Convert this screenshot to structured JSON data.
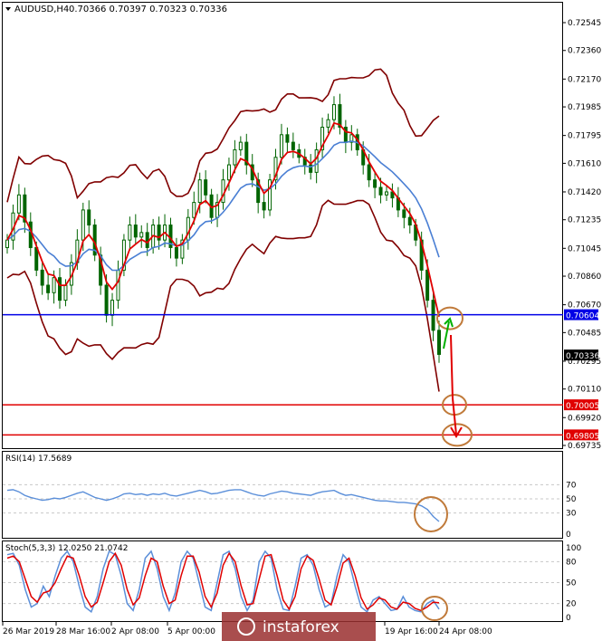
{
  "header": {
    "symbol_label": "AUDUSD,H4",
    "ohlc": "0.70366 0.70397 0.70323 0.70336"
  },
  "colors": {
    "candle": "#006400",
    "bollinger": "#800000",
    "ema_fast": "#e00000",
    "ema_slow": "#4a7fd4",
    "support_line": "#0000e6",
    "target_line": "#e00000",
    "rsi": "#5b8fd9",
    "stoch_main": "#5b8fd9",
    "stoch_signal": "#e00000",
    "annotation_circle": "#c07a3a",
    "arrow_up": "#00b000",
    "arrow_down": "#e00000"
  },
  "chart_data": [
    {
      "type": "candlestick",
      "panel": "price",
      "ylim": [
        0.697,
        0.724
      ],
      "y_ticks": [
        "0.72545",
        "0.72360",
        "0.72170",
        "0.71985",
        "0.71795",
        "0.71610",
        "0.71420",
        "0.71235",
        "0.71045",
        "0.70860",
        "0.70670",
        "0.70485",
        "0.70295",
        "0.70110",
        "0.69920",
        "0.69735"
      ],
      "y_tick_values": [
        0.72545,
        0.7236,
        0.7217,
        0.71985,
        0.71795,
        0.7161,
        0.7142,
        0.71235,
        0.71045,
        0.7086,
        0.7067,
        0.70485,
        0.70295,
        0.7011,
        0.6992,
        0.69735
      ],
      "x_ticks": [
        "26 Mar 2019",
        "28 Mar 16:00",
        "2 Apr 08:00",
        "5 Apr 00:00",
        "19 Apr 16:00",
        "24 Apr 08:00"
      ],
      "close": [
        0.711,
        0.7128,
        0.714,
        0.7122,
        0.7105,
        0.709,
        0.708,
        0.7075,
        0.7085,
        0.707,
        0.708,
        0.7095,
        0.711,
        0.713,
        0.712,
        0.71,
        0.708,
        0.706,
        0.707,
        0.709,
        0.711,
        0.712,
        0.7112,
        0.7115,
        0.7105,
        0.712,
        0.711,
        0.712,
        0.7105,
        0.7098,
        0.711,
        0.7125,
        0.7135,
        0.715,
        0.714,
        0.7125,
        0.7135,
        0.715,
        0.716,
        0.717,
        0.7175,
        0.716,
        0.715,
        0.7135,
        0.713,
        0.715,
        0.7165,
        0.718,
        0.7175,
        0.717,
        0.7165,
        0.716,
        0.7155,
        0.717,
        0.7185,
        0.719,
        0.72,
        0.7185,
        0.7175,
        0.718,
        0.717,
        0.716,
        0.715,
        0.7145,
        0.714,
        0.7142,
        0.7138,
        0.713,
        0.7125,
        0.712,
        0.711,
        0.709,
        0.707,
        0.705,
        0.7034
      ],
      "current_price_label": "0.70336",
      "lines": [
        {
          "label": "0.70604",
          "value": 0.70604,
          "role": "support"
        },
        {
          "label": "0.70005",
          "value": 0.70005,
          "role": "target"
        },
        {
          "label": "0.69805",
          "value": 0.69805,
          "role": "target"
        }
      ]
    },
    {
      "type": "line",
      "panel": "rsi",
      "title": "RSI(14) 17.5689",
      "ylim": [
        0,
        100
      ],
      "y_ticks": [
        "70",
        "50",
        "30",
        "0"
      ],
      "values": [
        62,
        63,
        60,
        55,
        52,
        50,
        48,
        49,
        51,
        50,
        52,
        55,
        58,
        60,
        56,
        52,
        50,
        48,
        50,
        53,
        57,
        58,
        56,
        57,
        55,
        57,
        56,
        58,
        55,
        54,
        56,
        58,
        60,
        62,
        60,
        57,
        58,
        60,
        62,
        63,
        63,
        60,
        57,
        55,
        54,
        57,
        59,
        61,
        60,
        58,
        57,
        56,
        55,
        58,
        60,
        61,
        62,
        58,
        55,
        56,
        54,
        52,
        50,
        48,
        47,
        47,
        46,
        45,
        45,
        44,
        43,
        40,
        35,
        25,
        18
      ]
    },
    {
      "type": "line",
      "panel": "stochastic",
      "title": "Stoch(5,3,3) 12.0250 21.0742",
      "ylim": [
        0,
        100
      ],
      "y_ticks": [
        "100",
        "80",
        "50",
        "20",
        "0"
      ],
      "series": [
        {
          "values": [
            90,
            92,
            75,
            40,
            15,
            20,
            45,
            30,
            60,
            85,
            95,
            80,
            45,
            15,
            8,
            30,
            70,
            95,
            90,
            60,
            20,
            10,
            40,
            85,
            95,
            70,
            30,
            10,
            35,
            80,
            95,
            85,
            50,
            15,
            10,
            50,
            90,
            95,
            70,
            30,
            10,
            25,
            80,
            95,
            85,
            40,
            12,
            10,
            45,
            85,
            90,
            75,
            40,
            15,
            20,
            60,
            90,
            80,
            45,
            15,
            8,
            25,
            30,
            20,
            10,
            12,
            30,
            15,
            10,
            8,
            20,
            25,
            12
          ]
        },
        {
          "values": [
            85,
            88,
            80,
            55,
            30,
            22,
            35,
            38,
            50,
            70,
            88,
            85,
            60,
            30,
            15,
            22,
            50,
            80,
            92,
            75,
            40,
            18,
            28,
            60,
            85,
            80,
            45,
            20,
            25,
            60,
            88,
            88,
            65,
            30,
            15,
            35,
            75,
            92,
            80,
            45,
            18,
            20,
            55,
            88,
            90,
            60,
            25,
            12,
            30,
            70,
            88,
            82,
            55,
            25,
            18,
            45,
            78,
            85,
            60,
            28,
            12,
            18,
            28,
            25,
            15,
            12,
            22,
            20,
            13,
            10,
            15,
            22,
            21
          ]
        }
      ]
    }
  ],
  "footer": {
    "watermark": "instaforex"
  }
}
